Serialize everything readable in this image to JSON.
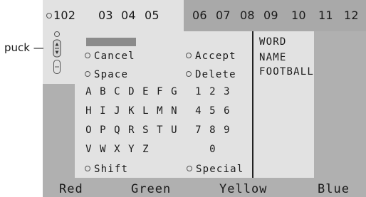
{
  "callout": {
    "label": "puck —"
  },
  "channels": [
    "102",
    "03",
    "04",
    "05",
    "06",
    "07",
    "08",
    "09",
    "10",
    "11",
    "12"
  ],
  "options": {
    "cancel": "Cancel",
    "accept": "Accept",
    "space": "Space",
    "delete": "Delete",
    "shift": "Shift",
    "special": "Special"
  },
  "keyboard": {
    "rows": [
      [
        "A",
        "B",
        "C",
        "D",
        "E",
        "F",
        "G",
        "1",
        "2",
        "3"
      ],
      [
        "H",
        "I",
        "J",
        "K",
        "L",
        "M",
        "N",
        "4",
        "5",
        "6"
      ],
      [
        "O",
        "P",
        "Q",
        "R",
        "S",
        "T",
        "U",
        "7",
        "8",
        "9"
      ],
      [
        "V",
        "W",
        "X",
        "Y",
        "Z",
        "",
        "",
        "",
        "0",
        ""
      ]
    ]
  },
  "word_list": [
    "WORD",
    "NAME",
    "FOOTBALL"
  ],
  "color_keys": [
    "Red",
    "Green",
    "Yellow",
    "Blue"
  ]
}
